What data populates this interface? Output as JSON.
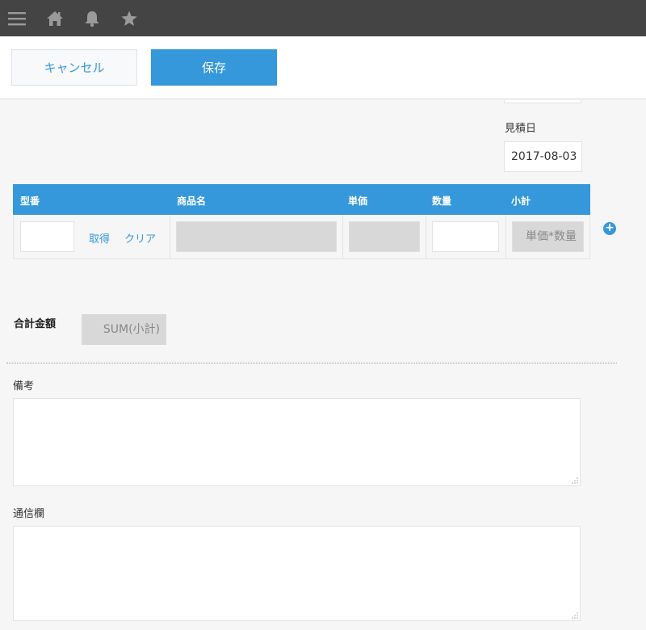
{
  "topbar": {
    "icons": [
      "menu-icon",
      "home-icon",
      "bell-icon",
      "star-icon"
    ]
  },
  "actions": {
    "cancel_label": "キャンセル",
    "save_label": "保存"
  },
  "estimate_date": {
    "label": "見積日",
    "value": "2017-08-03"
  },
  "table": {
    "headers": {
      "model": "型番",
      "product_name": "商品名",
      "unit_price": "単価",
      "quantity": "数量",
      "subtotal": "小計"
    },
    "row": {
      "model_value": "",
      "fetch_link": "取得",
      "clear_link": "クリア",
      "product_name_value": "",
      "unit_price_value": "",
      "quantity_value": "",
      "subtotal_value": "単価*数量"
    }
  },
  "total": {
    "label": "合計金額",
    "value": "SUM(小計)"
  },
  "remarks": {
    "label": "備考",
    "value": ""
  },
  "communication": {
    "label": "通信欄",
    "value": ""
  },
  "colors": {
    "accent": "#3498db",
    "topbar": "#444444",
    "readonly_fill": "#d8d8d8"
  }
}
